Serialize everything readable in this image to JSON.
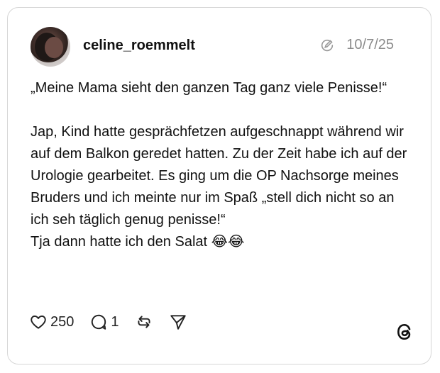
{
  "post": {
    "username": "celine_roemmelt",
    "date": "10/7/25",
    "paragraphs": [
      "„Meine Mama sieht den ganzen Tag ganz viele Penisse!“",
      "Jap, Kind hatte gesprächfetzen aufgeschnappt während wir auf dem Balkon geredet hatten. Zu der Zeit habe ich auf der Urologie gearbeitet. Es ging um die OP Nachsorge meines Bruders und ich meinte nur im Spaß „stell dich nicht so an ich seh täglich genug penisse!“",
      "Tja dann hatte ich den Salat 😂😂"
    ]
  },
  "actions": {
    "likes": "250",
    "replies": "1"
  },
  "icons": {
    "edit": "pencil-circle-icon",
    "like": "heart-icon",
    "reply": "speech-bubble-icon",
    "repost": "repost-icon",
    "share": "send-icon",
    "brand": "threads-logo-icon"
  }
}
